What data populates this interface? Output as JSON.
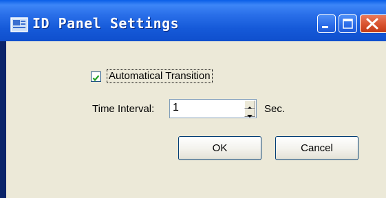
{
  "window": {
    "title": "ID Panel Settings",
    "icons": {
      "app": "app-icon",
      "minimize": "minimize-icon",
      "maximize": "maximize-icon",
      "close": "close-icon"
    },
    "colors": {
      "titlebar": "#1559D8",
      "client": "#ECE9D8",
      "close_button": "#D8522E"
    }
  },
  "form": {
    "auto_transition": {
      "label": "Automatical Transition",
      "checked": true
    },
    "interval": {
      "label": "Time Interval:",
      "value": "1",
      "unit": "Sec."
    }
  },
  "buttons": {
    "ok": "OK",
    "cancel": "Cancel"
  }
}
